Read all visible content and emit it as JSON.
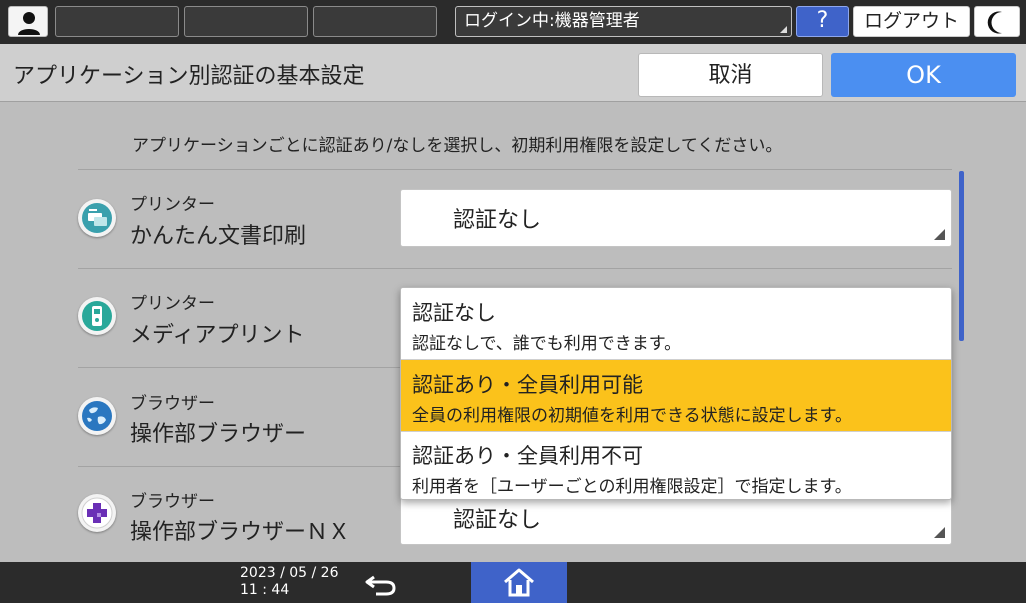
{
  "topbar": {
    "login_text": "ログイン中:機器管理者",
    "help_label": "?",
    "logout_label": "ログアウト"
  },
  "header": {
    "title": "アプリケーション別認証の基本設定",
    "cancel_label": "取消",
    "ok_label": "OK"
  },
  "main": {
    "instruction": "アプリケーションごとに認証あり/なしを選択し、初期利用権限を設定してください。",
    "apps": [
      {
        "category": "プリンター",
        "name": "かんたん文書印刷",
        "icon": "printer-document-icon",
        "value": "認証なし"
      },
      {
        "category": "プリンター",
        "name": "メディアプリント",
        "icon": "usb-media-icon",
        "value": ""
      },
      {
        "category": "ブラウザー",
        "name": "操作部ブラウザー",
        "icon": "globe-icon",
        "value": ""
      },
      {
        "category": "ブラウザー",
        "name": "操作部ブラウザーＮＸ",
        "icon": "browser-nx-icon",
        "value": "認証なし"
      }
    ]
  },
  "dropdown": {
    "options": [
      {
        "title": "認証なし",
        "desc": "認証なしで、誰でも利用できます。"
      },
      {
        "title": "認証あり・全員利用可能",
        "desc": "全員の利用権限の初期値を利用できる状態に設定します。",
        "selected": true
      },
      {
        "title": "認証あり・全員利用不可",
        "desc": "利用者を［ユーザーごとの利用権限設定］で指定します。"
      }
    ]
  },
  "footer": {
    "date": "2023 / 05 / 26",
    "time": "11 : 44"
  },
  "colors": {
    "accent_blue": "#3f63c9",
    "ok_blue": "#4b8ff1",
    "selected_yellow": "#fbc21b"
  }
}
